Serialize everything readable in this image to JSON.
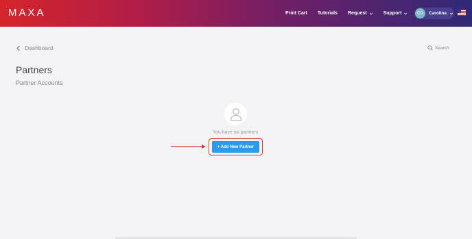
{
  "header": {
    "logo": "MAXA",
    "nav": [
      {
        "label": "Print Cart",
        "has_dropdown": false
      },
      {
        "label": "Tutorials",
        "has_dropdown": false
      },
      {
        "label": "Request",
        "has_dropdown": true
      },
      {
        "label": "Support",
        "has_dropdown": true
      }
    ],
    "user": {
      "initials": "CO",
      "name": "Carolina"
    },
    "flag_icon": "us-flag-icon",
    "gradient_colors": [
      "#d5252b",
      "#2f2a78"
    ]
  },
  "toolbar": {
    "back_label": "Dashboard",
    "search_label": "Search"
  },
  "page": {
    "title": "Partners",
    "subtitle": "Partner Accounts"
  },
  "empty_state": {
    "message": "You have no partners",
    "button_label": "+ Add New Partner",
    "button_color": "#2e98ea",
    "highlight_color": "#d9362b"
  }
}
